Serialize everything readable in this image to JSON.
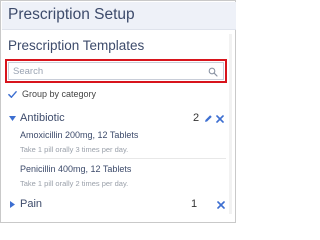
{
  "header": {
    "title": "Prescription Setup"
  },
  "templates": {
    "title": "Prescription Templates"
  },
  "search": {
    "value": "",
    "placeholder": "Search"
  },
  "group_by": {
    "label": "Group by category",
    "checked": true
  },
  "categories": [
    {
      "name": "Antibiotic",
      "count": "2",
      "expanded": true,
      "items": [
        {
          "name": "Amoxicillin 200mg, 12 Tablets",
          "instructions": "Take 1 pill orally 3 times per day."
        },
        {
          "name": "Penicillin 400mg, 12 Tablets",
          "instructions": "Take 1 pill orally 2 times per day."
        }
      ]
    },
    {
      "name": "Pain",
      "count": "1",
      "expanded": false,
      "items": []
    }
  ],
  "colors": {
    "accent": "#3d6fd1",
    "highlight": "#d8141c",
    "header_bg": "#eef1f8",
    "title_text": "#3d4b6b"
  }
}
